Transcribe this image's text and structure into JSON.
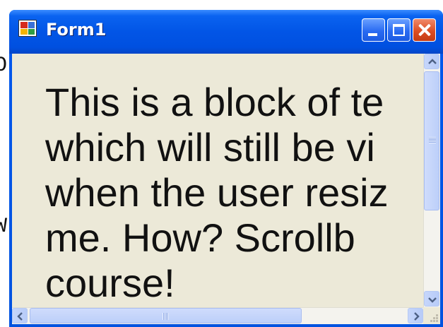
{
  "background": {
    "fragment_top": "O",
    "fragment_bottom": "W"
  },
  "window": {
    "title": "Form1",
    "icon": "form-app-icon",
    "controls": {
      "minimize": "minimize-icon",
      "maximize": "maximize-icon",
      "close": "close-icon"
    }
  },
  "content": {
    "text": "This is a block of te\nwhich will still be vi\nwhen the user resiz\nme.  How?  Scrollb\ncourse!"
  },
  "scrollbars": {
    "vertical": {
      "up_icon": "scroll-up-arrow-icon",
      "down_icon": "scroll-down-arrow-icon",
      "position_fraction": 0.0
    },
    "horizontal": {
      "left_icon": "scroll-left-arrow-icon",
      "right_icon": "scroll-right-arrow-icon",
      "position_fraction": 0.0
    }
  },
  "colors": {
    "titlebar": "#0055e5",
    "client_bg": "#ece9d8",
    "close_button": "#dc4e24",
    "scroll_accent": "#bccff9"
  }
}
